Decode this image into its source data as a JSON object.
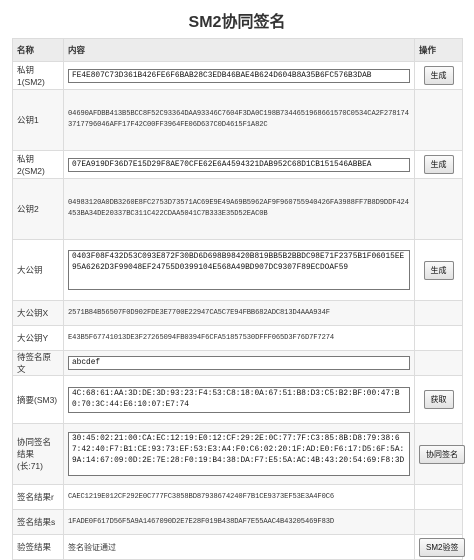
{
  "page_title": "SM2协同签名",
  "headers": {
    "name": "名称",
    "content": "内容",
    "op": "操作"
  },
  "rows": {
    "priv1": {
      "label": "私钥1(SM2)",
      "value": "FE4E807C73D361B426FE6F6BAB28C3EDB46BAE4B624D604B8A35B6FC576B3DAB",
      "button": "生成"
    },
    "pub1": {
      "label": "公钥1",
      "value": "04690AFDBB413B5BCC8F52C93364DAA93346C7604F3DA0C198B7344651968661570C0534CA2F2781743717796046AFF17F42C00FF3964FE06D637C0D4615F1A82C"
    },
    "priv2": {
      "label": "私钥2(SM2)",
      "value": "07EA919DF36D7E15D29F8AE70CFE62E6A4594321DAB952C68D1CB151546ABBEA",
      "button": "生成"
    },
    "pub2": {
      "label": "公钥2",
      "value": "04983120A0DB3260E8FC2753D73571AC69E9E49A69B5962AF9F960755940426FA3988FF7B8D9DDF424453BA34DE20337BC311C422CDAA5041C7B333E35D52EAC0B"
    },
    "bigpriv": {
      "label": "大公钥",
      "value": "0403F08F432D53C093E872F30BD6D698B98420B819BB5B2BBDC98E71F2375B1F06015EE95A6262D3F99048EF24755D0399104E568A49BD907DC9307F89ECDOAF59",
      "button": "生成"
    },
    "bigx": {
      "label": "大公钥X",
      "value": "2571B84B56507F0D902FDE3E7700E22947CA5C7E94FBB682ADC813D4AAA934F"
    },
    "bigy": {
      "label": "大公钥Y",
      "value": "E43B5F67741013DE3F27265094FB0394F6CFA51857530DFFF065D3F76D7F7274"
    },
    "plain": {
      "label": "待签名原文",
      "value": "abcdef"
    },
    "digest": {
      "label": "摘要(SM3)",
      "value": "4C:68:61:AA:3D:DE:3D:93:23:F4:53:C8:18:0A:67:51:B8:D3:C5:B2:BF:00:47:B0:70:3C:44:E6:10:07:E7:74",
      "button": "获取"
    },
    "sigres": {
      "label": "协同签名结果(长:71)",
      "value": "30:45:02:21:00:CA:EC:12:19:E0:12:CF:29:2E:0C:77:7F:C3:85:8B:D8:79:38:67:42:40:F7:B1:CE:93:73:EF:53:E3:A4:F0:C6:02:20:1F:AD:E0:F6:17:D5:6F:5A:9A:14:67:09:0D:2E:7E:28:F0:19:B4:38:DA:F7:E5:5A:AC:4B:43:20:54:69:F8:3D",
      "button": "协同签名"
    },
    "sigr": {
      "label": "签名结果r",
      "value": "CAEC1219E012CF292E0C777FC3858BD87938674240F7B1CE9373EF53E3A4F0C6"
    },
    "sigs": {
      "label": "签名结果s",
      "value": "1FADE0F617D56F5A9A1467090D2E7E28F019B438DAF7E55AAC4B43205469F83D"
    },
    "verify": {
      "label": "验签结果",
      "value": "签名验证通过",
      "button": "SM2验签"
    }
  },
  "colors": {
    "header_bg": "#ececec",
    "border": "#dcdcdc",
    "button_bg": "#e8e8e8"
  }
}
